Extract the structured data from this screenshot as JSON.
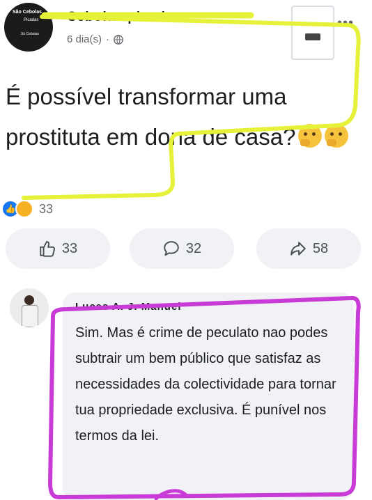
{
  "page": {
    "avatar_lines": [
      "São Cebolas",
      "Picadas",
      "Só Cebolas"
    ],
    "name": "Cebolas picadas",
    "time": "6 dia(s)",
    "time_separator": "·",
    "more_icon": "more-dots-icon",
    "privacy_icon": "globe-icon"
  },
  "post": {
    "text": "É possível transformar uma prostituta em dona de casa?",
    "emojis": [
      "thinking-face-emoji",
      "thinking-face-emoji"
    ]
  },
  "reactions": {
    "icons": [
      "like-reaction-icon",
      "care-reaction-icon"
    ],
    "count": "33"
  },
  "actions": {
    "like": {
      "icon": "thumbs-up-icon",
      "count": "33"
    },
    "comment": {
      "icon": "comment-bubble-icon",
      "count": "32"
    },
    "share": {
      "icon": "share-arrow-icon",
      "count": "58"
    }
  },
  "comment": {
    "author": "Lucas A. J. Manuel",
    "text": "Sim. Mas é crime de   peculato nao podes subtrair um bem público que satisfaz as necessidades da colectividade para tornar tua propriedade exclusiva. É punível nos termos da lei."
  },
  "annotations": {
    "highlight_color": "#e6f23a",
    "comment_box_color": "#c93bd6"
  },
  "colors": {
    "text": "#1c1e21",
    "muted": "#65676b",
    "like_blue": "#1877f2",
    "bubble_bg": "#f0f2f5"
  }
}
